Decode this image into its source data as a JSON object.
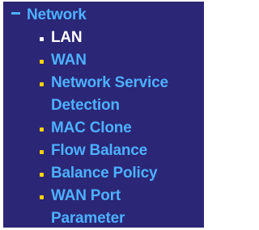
{
  "menu": {
    "header": {
      "symbol": "−",
      "label": "Network"
    },
    "items": [
      {
        "lines": [
          "LAN"
        ],
        "active": true
      },
      {
        "lines": [
          "WAN"
        ],
        "active": false
      },
      {
        "lines": [
          "Network Service",
          "Detection"
        ],
        "active": false
      },
      {
        "lines": [
          "MAC Clone"
        ],
        "active": false
      },
      {
        "lines": [
          "Flow Balance"
        ],
        "active": false
      },
      {
        "lines": [
          "Balance Policy"
        ],
        "active": false
      },
      {
        "lines": [
          "WAN Port",
          "Parameter"
        ],
        "active": false
      }
    ]
  },
  "colors": {
    "panel_background": "#2b2675",
    "link_text": "#4cb1ff",
    "active_text": "#ffffff",
    "bullet": "#ffd400"
  }
}
